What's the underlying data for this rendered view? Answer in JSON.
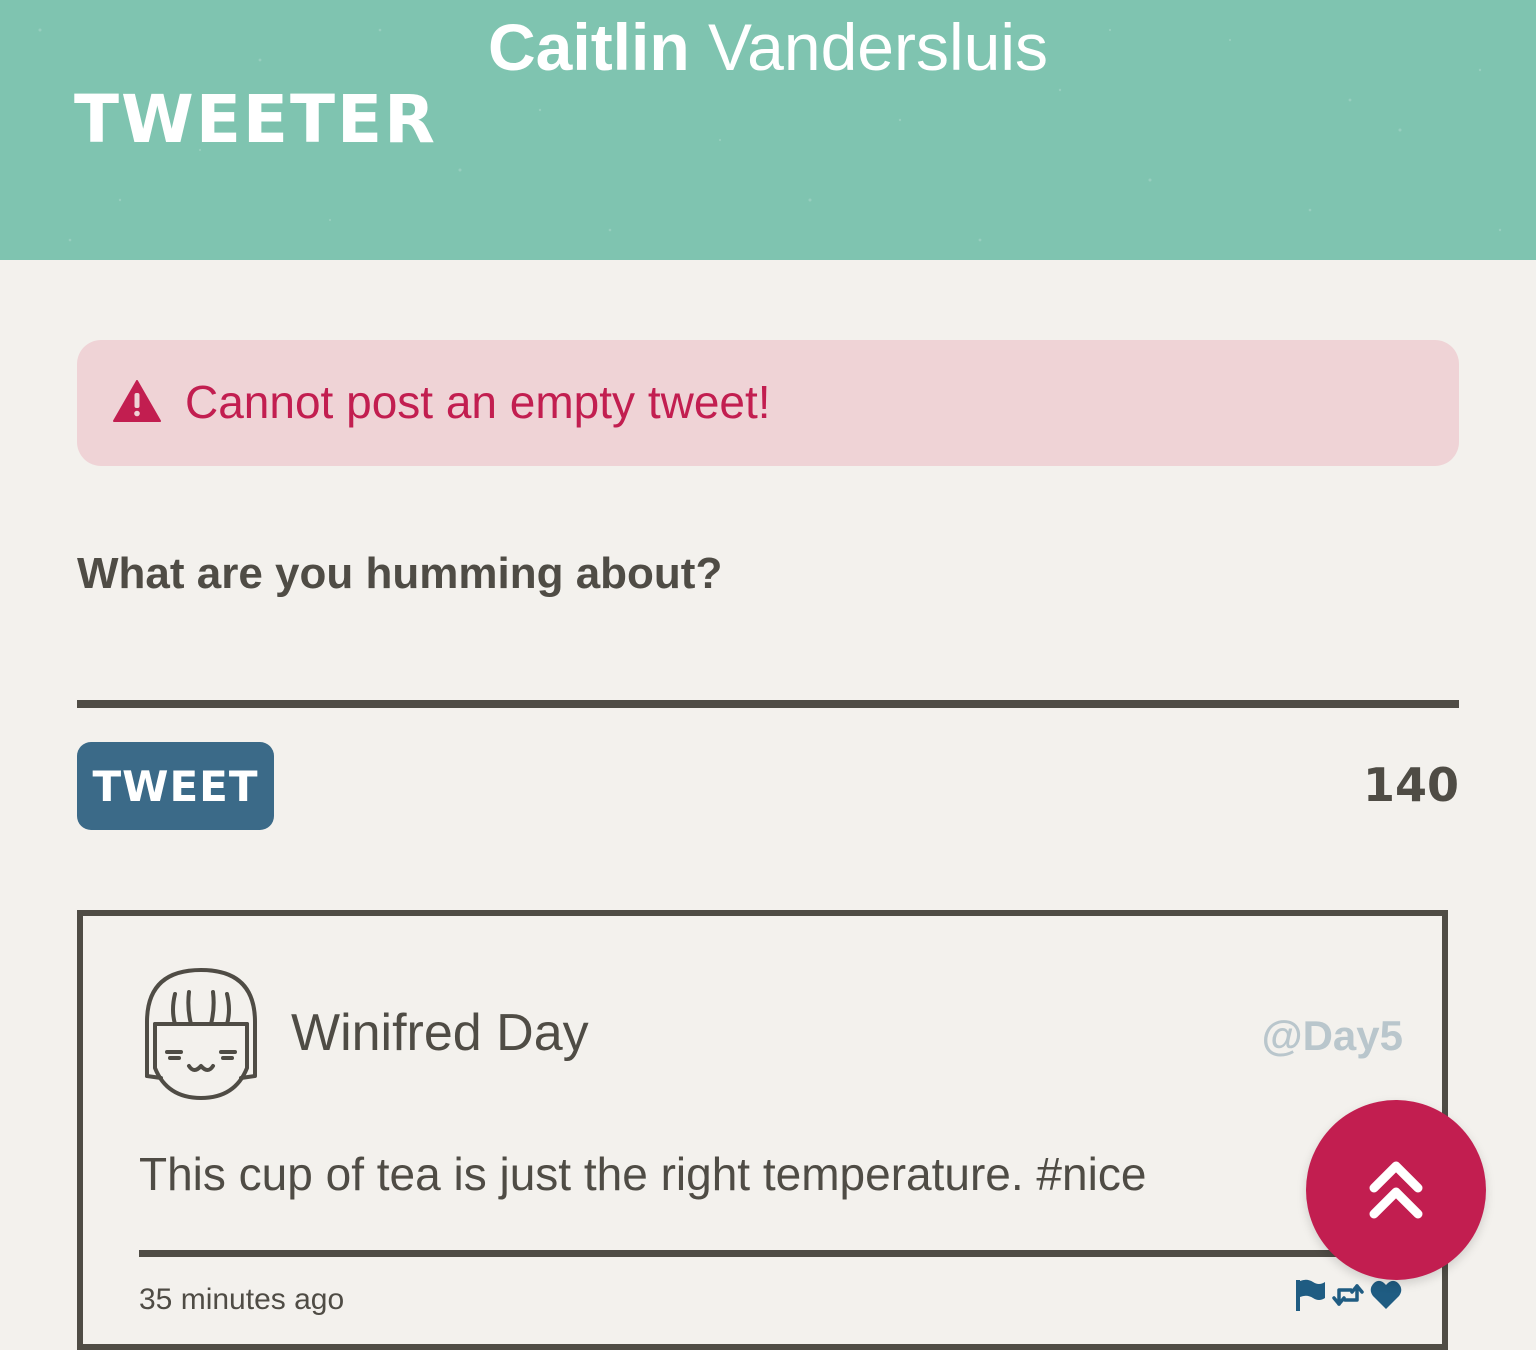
{
  "header": {
    "user_first_name": "Caitlin",
    "user_last_name": "Vandersluis",
    "logo_text": "TWEETER",
    "background_color": "#7fc4b0"
  },
  "alert": {
    "icon": "warning-triangle-icon",
    "message": "Cannot post an empty tweet!",
    "color": "#c21e50",
    "background_color": "#efd3d6"
  },
  "composer": {
    "prompt": "What are you humming about?",
    "input_value": "",
    "button_label": "TWEET",
    "button_color": "#3b6a88",
    "char_count": "140"
  },
  "tweets": [
    {
      "avatar": "girl-face-avatar-icon",
      "author": "Winifred Day",
      "handle": "@Day5",
      "text": "This cup of tea is just the right temperature. #nice",
      "time": "35 minutes ago",
      "actions": [
        "flag-icon",
        "retweet-icon",
        "heart-icon"
      ],
      "action_color": "#1f5c82"
    }
  ],
  "scroll_top": {
    "icon": "double-chevron-up-icon",
    "color": "#c21e50"
  }
}
